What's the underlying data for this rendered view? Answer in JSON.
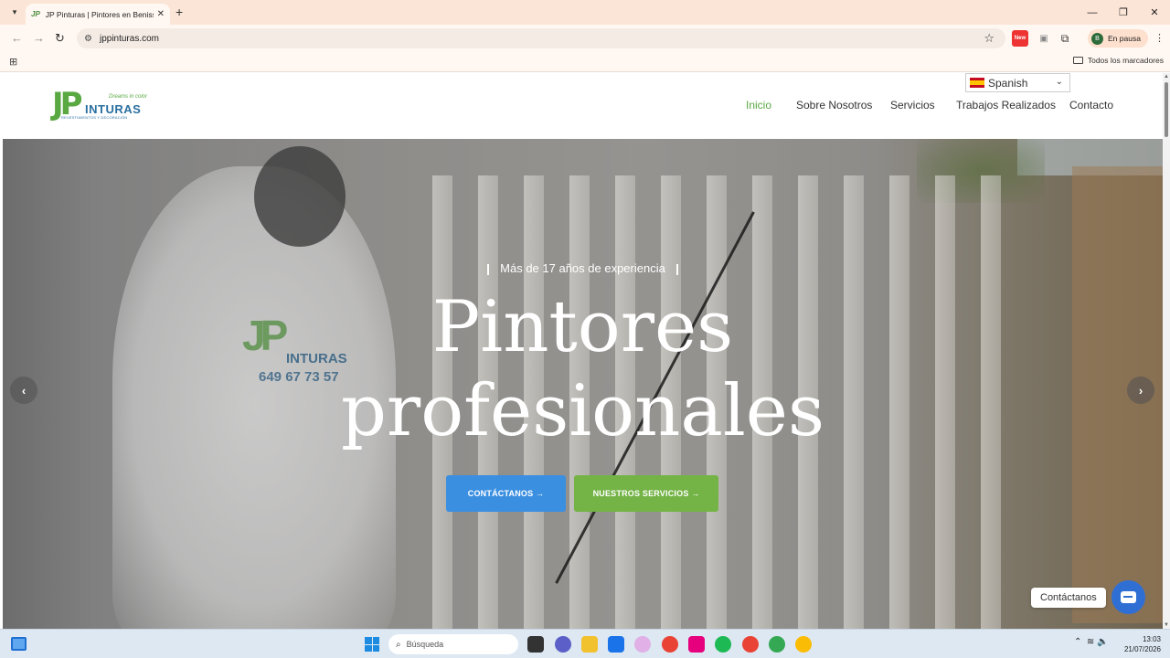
{
  "browser": {
    "tab_title": "JP Pinturas | Pintores en Benissa",
    "tab_favicon": "JP",
    "url": "jppinturas.com",
    "profile_status": "En pausa",
    "profile_initial": "B",
    "bookmarks_all": "Todos los marcadores",
    "extension_badge": "New"
  },
  "site": {
    "logo": {
      "jp": "JP",
      "name": "INTURAS",
      "slogan": "Dreams in color",
      "subtitle": "REVESTIMIENTOS Y DECORACIÓN"
    },
    "language": "Spanish",
    "nav": [
      {
        "label": "Inicio",
        "active": true
      },
      {
        "label": "Sobre Nosotros"
      },
      {
        "label": "Servicios"
      },
      {
        "label": "Trabajos Realizados"
      },
      {
        "label": "Contacto"
      }
    ],
    "hero": {
      "eyebrow": "Más de 17 años de experiencia",
      "headline_line1": "Pintores",
      "headline_line2": "profesionales",
      "cta_primary": "CONTÁCTANOS →",
      "cta_secondary": "NUESTROS SERVICIOS →",
      "shirt_logo": "JP",
      "shirt_text": "INTURAS",
      "shirt_phone": "649 67 73 57"
    },
    "chat_label": "Contáctanos"
  },
  "taskbar": {
    "search_placeholder": "Búsqueda",
    "time": "13:03",
    "date": "21/07/2026"
  },
  "colors": {
    "brand_green": "#5aa842",
    "brand_blue": "#2a6fa0",
    "cta_blue": "#3b8fe0",
    "cta_green": "#74b346",
    "chat_blue": "#2f6fd4"
  }
}
